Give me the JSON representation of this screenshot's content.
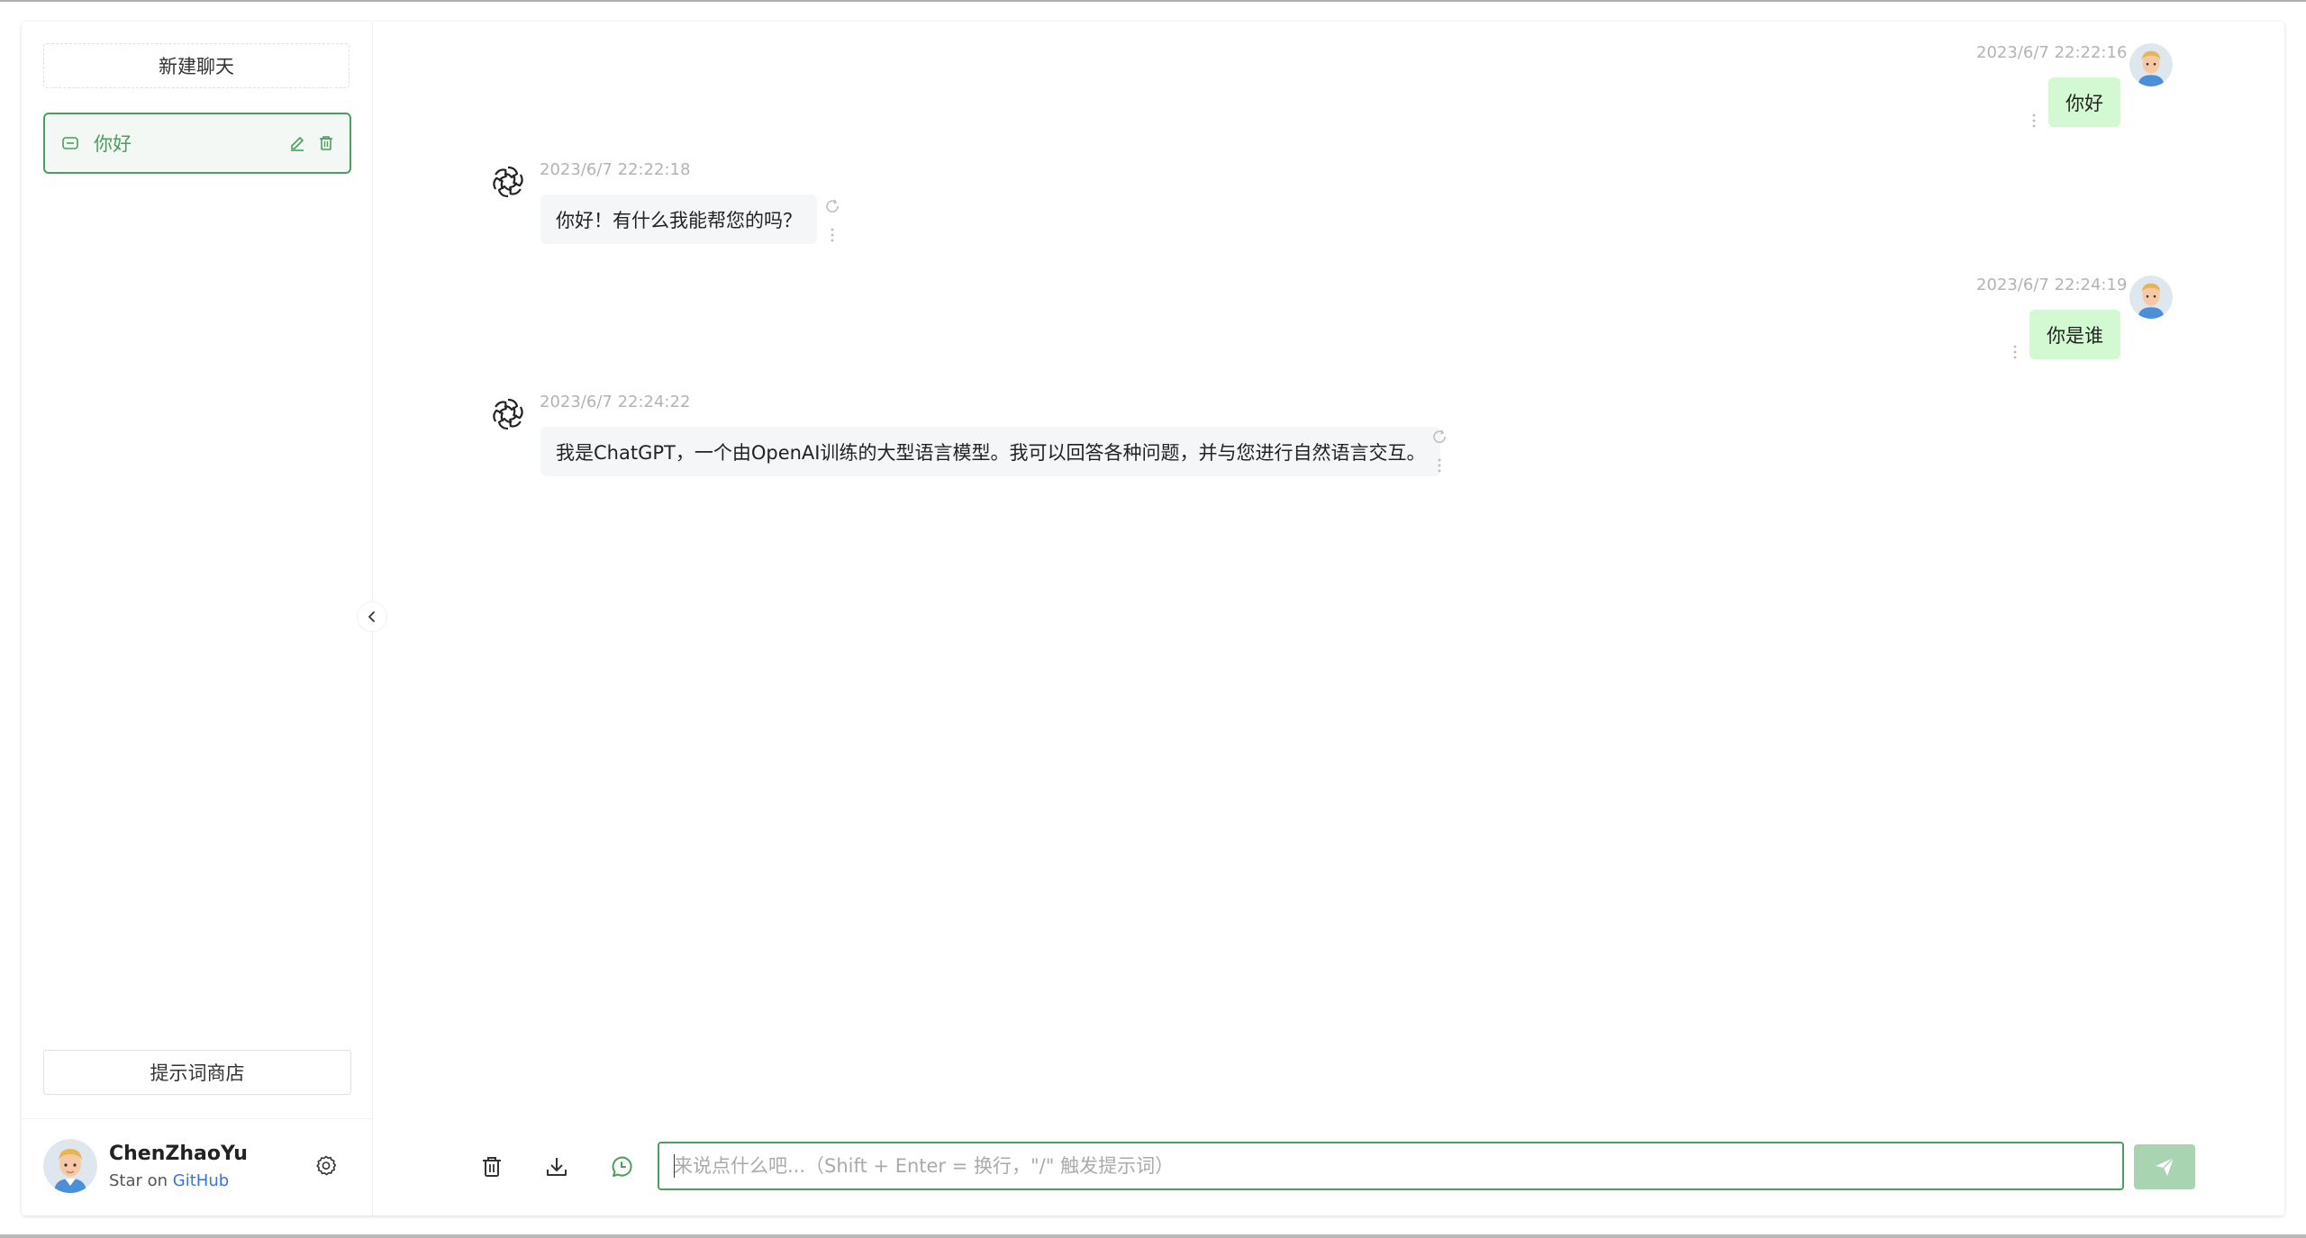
{
  "sidebar": {
    "new_chat_label": "新建聊天",
    "history": [
      {
        "title": "你好",
        "active": true
      }
    ],
    "prompt_store_label": "提示词商店",
    "user": {
      "name": "ChenZhaoYu",
      "desc_prefix": "Star on",
      "desc_link": "GitHub"
    }
  },
  "messages": [
    {
      "role": "user",
      "time": "2023/6/7 22:22:16",
      "text": "你好"
    },
    {
      "role": "assistant",
      "time": "2023/6/7 22:22:18",
      "text": "你好！有什么我能帮您的吗？"
    },
    {
      "role": "user",
      "time": "2023/6/7 22:24:19",
      "text": "你是谁"
    },
    {
      "role": "assistant",
      "time": "2023/6/7 22:24:22",
      "text": "我是ChatGPT，一个由OpenAI训练的大型语言模型。我可以回答各种问题，并与您进行自然语言交互。"
    }
  ],
  "footer": {
    "input_value": "",
    "input_placeholder": "来说点什么吧...（Shift + Enter = 换行，\"/\" 触发提示词）"
  },
  "colors": {
    "accent": "#4b9e5f",
    "user_bubble": "#d2f9d1",
    "bot_bubble": "#f4f6f8",
    "send_button": "#a8d4b2",
    "link": "#3a72d8"
  },
  "icons": {
    "history_item": "chat-bubble-icon",
    "edit": "edit-icon",
    "delete": "trash-icon",
    "settings": "gear-icon",
    "collapse": "chevron-left-icon",
    "assistant_avatar": "openai-logo-icon",
    "more": "more-vertical-icon",
    "regenerate": "refresh-icon",
    "clear": "trash-icon",
    "download": "download-icon",
    "context": "whatsapp-context-icon",
    "send": "send-icon"
  }
}
